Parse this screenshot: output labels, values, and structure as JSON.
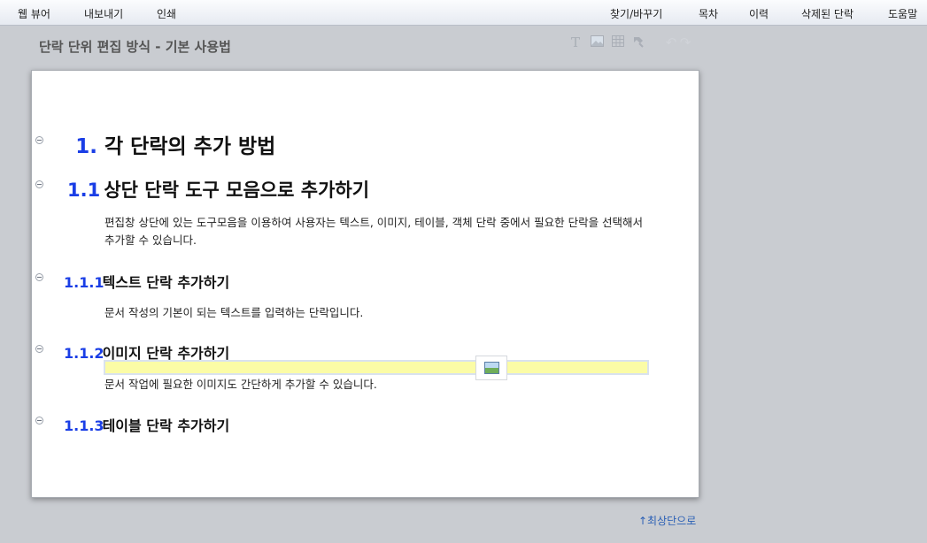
{
  "menu": {
    "left": [
      "웹 뷰어",
      "내보내기",
      "인쇄"
    ],
    "right": [
      "찾기/바꾸기",
      "목차",
      "이력",
      "삭제된 단락",
      "도움말"
    ]
  },
  "doc_title": "단락 단위 편집 방식 - 기본 사용법",
  "toolbar_icons": [
    "text-icon",
    "image-icon",
    "table-icon",
    "object-icon",
    "undo-icon",
    "redo-icon"
  ],
  "sections": [
    {
      "num": "1.",
      "title": "각 단락의 추가 방법"
    },
    {
      "num": "1.1",
      "title": "상단 단락 도구 모음으로 추가하기",
      "text": "편집창 상단에 있는 도구모음을 이용하여 사용자는 텍스트, 이미지, 테이블, 객체 단락 중에서 필요한 단락을 선택해서 추가할 수 있습니다."
    },
    {
      "num": "1.1.1",
      "title": "텍스트 단락 추가하기",
      "text": "문서 작성의 기본이 되는 텍스트를 입력하는 단락입니다."
    },
    {
      "num": "1.1.2",
      "title": "이미지 단락 추가하기",
      "text": "문서 작업에 필요한 이미지도 간단하게 추가할 수 있습니다."
    },
    {
      "num": "1.1.3",
      "title": "테이블 단락 추가하기"
    }
  ],
  "back_to_top": "↑최상단으로"
}
